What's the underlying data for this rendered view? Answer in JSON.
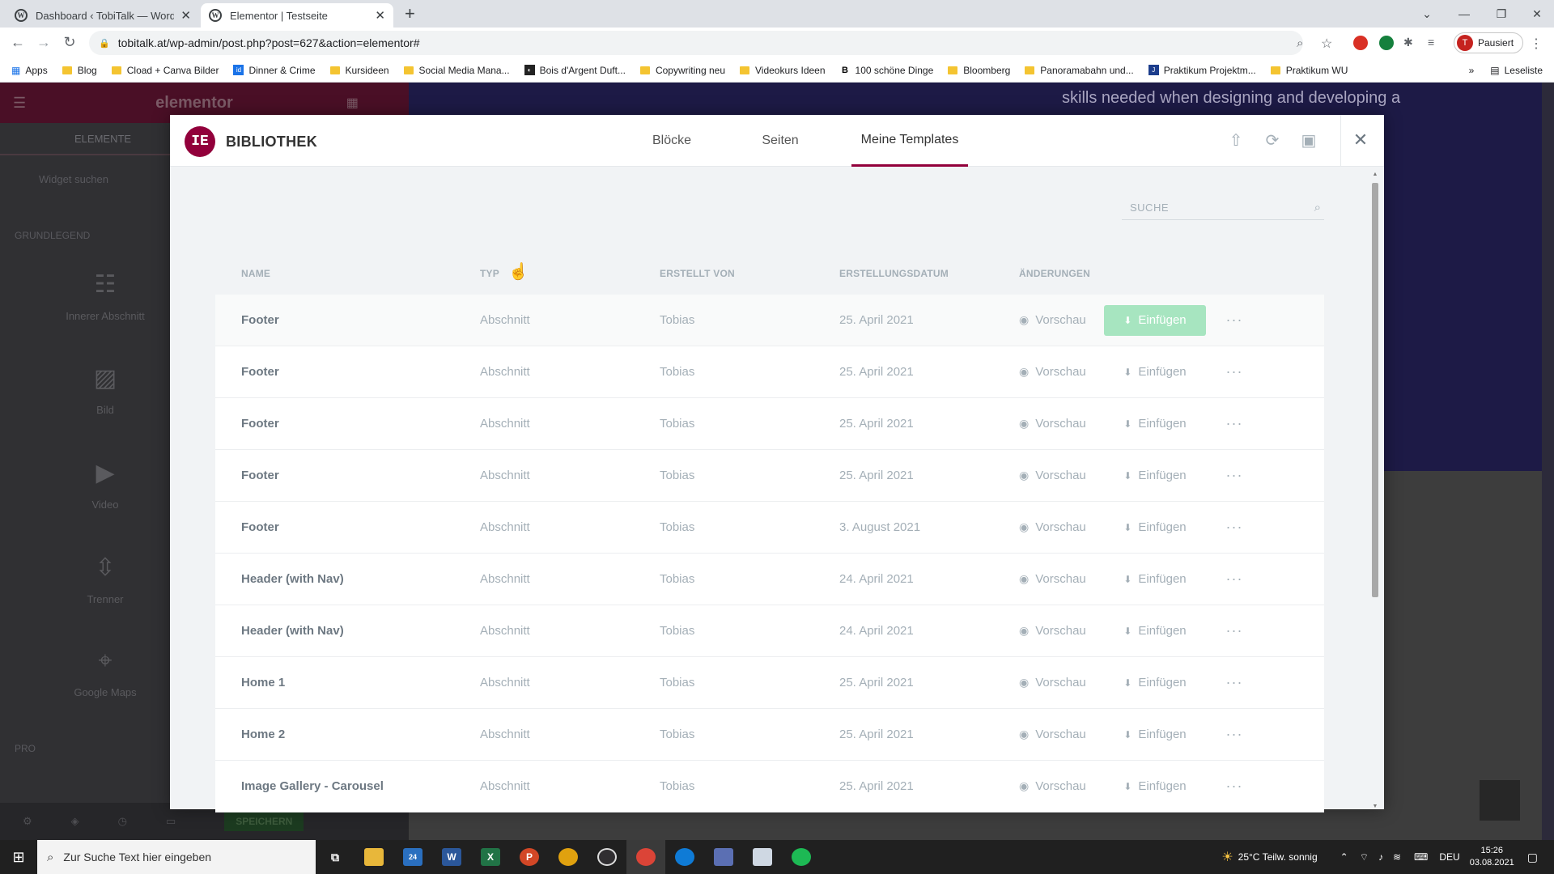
{
  "browser": {
    "tabs": [
      {
        "title": "Dashboard ‹ TobiTalk — WordPre",
        "close": "✕"
      },
      {
        "title": "Elementor | Testseite",
        "close": "✕"
      }
    ],
    "new_tab": "+",
    "url": "tobitalk.at/wp-admin/post.php?post=627&action=elementor#",
    "profile_initial": "T",
    "profile_label": "Pausiert",
    "bookmarks": [
      "Apps",
      "Blog",
      "Cload + Canva Bilder",
      "Dinner & Crime",
      "Kursideen",
      "Social Media Mana...",
      "Bois d'Argent Duft...",
      "Copywriting neu",
      "Videokurs Ideen",
      "100 schöne Dinge",
      "Bloomberg",
      "Panoramabahn und...",
      "Praktikum Projektm...",
      "Praktikum WU"
    ],
    "more_bookmarks": "»",
    "reading_list": "Leseliste"
  },
  "page": {
    "hero_text": "skills needed when designing and developing a"
  },
  "editor_panel": {
    "logo": "elementor",
    "tab": "ELEMENTE",
    "search_placeholder": "Widget suchen",
    "group_basic": "GRUNDLEGEND",
    "group_pro": "PRO",
    "widgets": [
      "Innerer Abschnitt",
      "Bild",
      "Video",
      "Trenner",
      "Google Maps"
    ],
    "save_label": "SPEICHERN"
  },
  "modal": {
    "title": "BIBLIOTHEK",
    "tabs": [
      "Blöcke",
      "Seiten",
      "Meine Templates"
    ],
    "active_tab": "Meine Templates",
    "search_placeholder": "SUCHE",
    "columns": {
      "name": "NAME",
      "type": "TYP",
      "author": "ERSTELLT VON",
      "date": "ERSTELLUNGSDATUM",
      "changes": "ÄNDERUNGEN"
    },
    "preview_label": "Vorschau",
    "insert_label": "Einfügen",
    "more_label": "···",
    "rows": [
      {
        "name": "Footer",
        "type": "Abschnitt",
        "author": "Tobias",
        "date": "25. April 2021"
      },
      {
        "name": "Footer",
        "type": "Abschnitt",
        "author": "Tobias",
        "date": "25. April 2021"
      },
      {
        "name": "Footer",
        "type": "Abschnitt",
        "author": "Tobias",
        "date": "25. April 2021"
      },
      {
        "name": "Footer",
        "type": "Abschnitt",
        "author": "Tobias",
        "date": "25. April 2021"
      },
      {
        "name": "Footer",
        "type": "Abschnitt",
        "author": "Tobias",
        "date": "3. August 2021"
      },
      {
        "name": "Header (with Nav)",
        "type": "Abschnitt",
        "author": "Tobias",
        "date": "24. April 2021"
      },
      {
        "name": "Header (with Nav)",
        "type": "Abschnitt",
        "author": "Tobias",
        "date": "24. April 2021"
      },
      {
        "name": "Home 1",
        "type": "Abschnitt",
        "author": "Tobias",
        "date": "25. April 2021"
      },
      {
        "name": "Home 2",
        "type": "Abschnitt",
        "author": "Tobias",
        "date": "25. April 2021"
      },
      {
        "name": "Image Gallery - Carousel",
        "type": "Abschnitt",
        "author": "Tobias",
        "date": "25. April 2021"
      }
    ]
  },
  "taskbar": {
    "search_placeholder": "Zur Suche Text hier eingeben",
    "weather": "25°C  Teilw. sonnig",
    "language": "DEU",
    "time": "15:26",
    "date": "03.08.2021",
    "mail_badge": "24"
  },
  "colors": {
    "brand": "#92003b",
    "insert_highlight": "#a7e5c0",
    "muted_text": "#a4afb7"
  }
}
